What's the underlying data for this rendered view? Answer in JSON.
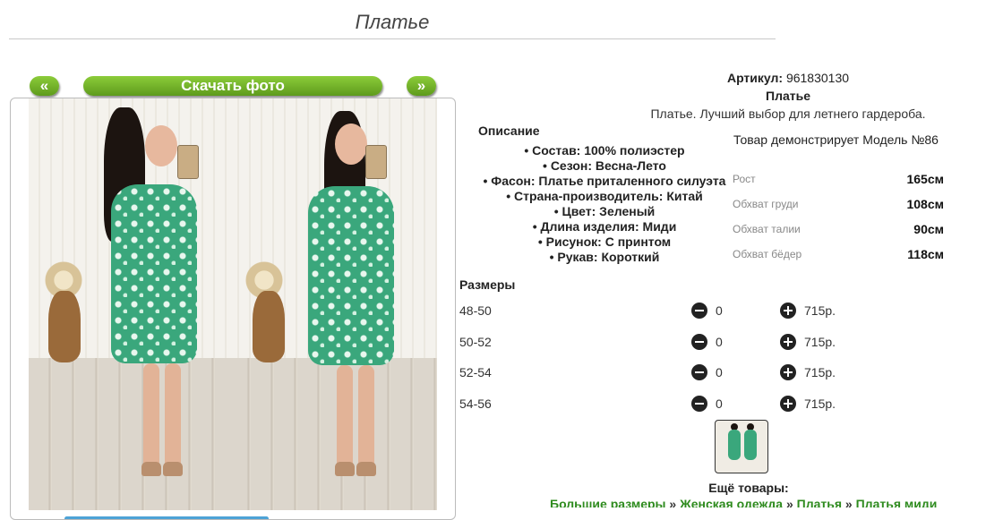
{
  "page": {
    "title": "Платье"
  },
  "gallery": {
    "prev_label": "«",
    "next_label": "»",
    "download_label": "Скачать фото"
  },
  "product": {
    "article_label": "Артикул:",
    "article_value": "961830130",
    "name": "Платье",
    "tagline": "Платье. Лучший выбор для летнего гардероба."
  },
  "description": {
    "heading": "Описание",
    "items": [
      "• Состав: 100% полиэстер",
      "• Сезон: Весна-Лето",
      "• Фасон: Платье приталенного силуэта",
      "• Страна-производитель: Китай",
      "• Цвет: Зеленый",
      "• Длина изделия: Миди",
      "• Рисунок: С принтом",
      "• Рукав: Короткий"
    ]
  },
  "model": {
    "heading": "Товар демонстрирует Модель №86",
    "measurements": [
      {
        "label": "Рост",
        "value": "165см"
      },
      {
        "label": "Обхват груди",
        "value": "108см"
      },
      {
        "label": "Обхват талии",
        "value": "90см"
      },
      {
        "label": "Обхват бёдер",
        "value": "118см"
      }
    ]
  },
  "sizes": {
    "heading": "Размеры",
    "rows": [
      {
        "size": "48-50",
        "qty": "0",
        "price": "715р."
      },
      {
        "size": "50-52",
        "qty": "0",
        "price": "715р."
      },
      {
        "size": "52-54",
        "qty": "0",
        "price": "715р."
      },
      {
        "size": "54-56",
        "qty": "0",
        "price": "715р."
      }
    ]
  },
  "more": {
    "heading": "Ещё товары:",
    "links": [
      "Большие размеры",
      "Женская одежда",
      "Платья",
      "Платья миди"
    ],
    "separator": " » "
  },
  "colors": {
    "accent_green": "#5e9b1c",
    "link_green": "#2e8b1e",
    "dress_green": "#3aa77c"
  },
  "icons": [
    "minus-circle-icon",
    "plus-circle-icon"
  ]
}
